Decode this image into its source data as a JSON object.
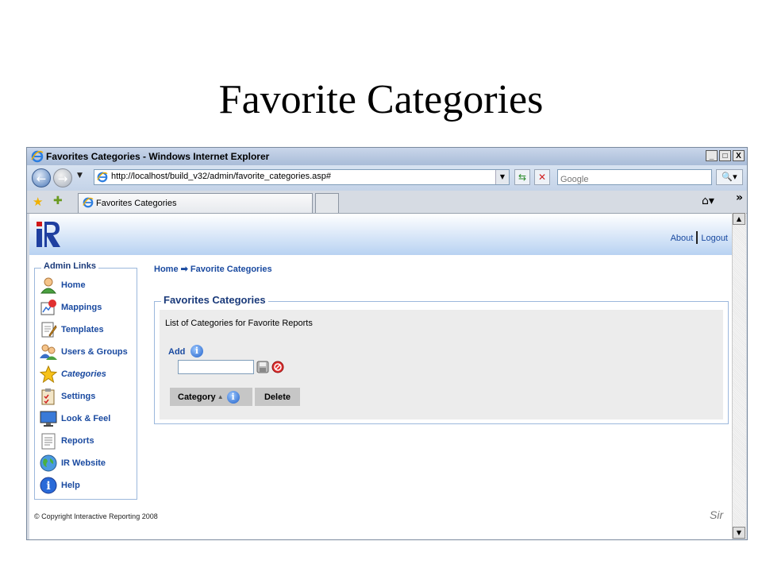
{
  "slide_title": "Favorite Categories",
  "window": {
    "title": "Favorites Categories - Windows Internet Explorer",
    "controls": [
      "_",
      "□",
      "X"
    ]
  },
  "address_bar": {
    "url": "http://localhost/build_v32/admin/favorite_categories.asp#",
    "search_placeholder": "Google"
  },
  "tab": {
    "label": "Favorites Categories"
  },
  "header": {
    "about": "About",
    "logout": "Logout"
  },
  "sidebar": {
    "legend": "Admin Links",
    "items": [
      {
        "label": "Home",
        "icon": "user-icon"
      },
      {
        "label": "Mappings",
        "icon": "mappings-icon"
      },
      {
        "label": "Templates",
        "icon": "templates-icon"
      },
      {
        "label": "Users & Groups",
        "icon": "users-groups-icon"
      },
      {
        "label": "Categories",
        "icon": "star-icon",
        "active": true
      },
      {
        "label": "Settings",
        "icon": "settings-icon"
      },
      {
        "label": "Look & Feel",
        "icon": "monitor-icon"
      },
      {
        "label": "Reports",
        "icon": "reports-icon"
      },
      {
        "label": "IR Website",
        "icon": "globe-icon"
      },
      {
        "label": "Help",
        "icon": "help-icon"
      }
    ]
  },
  "breadcrumb": {
    "home": "Home",
    "arrow": "➡",
    "current": "Favorite Categories"
  },
  "panel": {
    "legend": "Favorites Categories",
    "description": "List of Categories for Favorite Reports",
    "add_label": "Add",
    "add_value": "",
    "table": {
      "headers": [
        "Category",
        "Delete"
      ],
      "rows": []
    }
  },
  "footer": {
    "copyright": "© Copyright Interactive Reporting 2008",
    "signature": "Sir"
  },
  "colors": {
    "link": "#1a4aa0",
    "header_gradient_end": "#b8d2f2"
  }
}
